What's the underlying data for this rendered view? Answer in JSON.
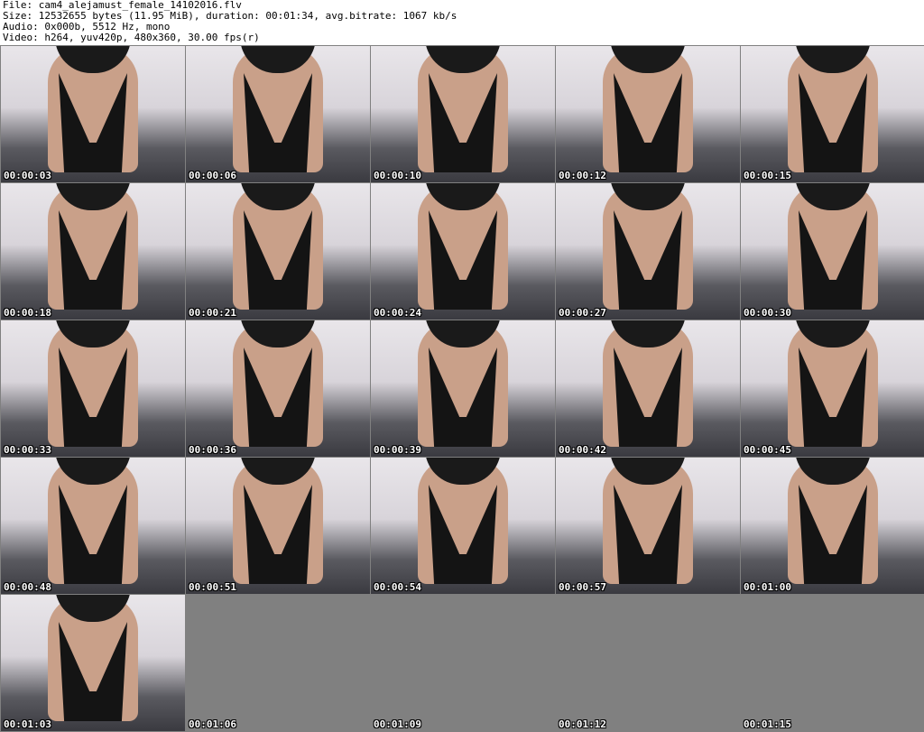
{
  "header": {
    "file": "File: cam4_alejamust_female_14102016.flv",
    "size": "Size: 12532655 bytes (11.95 MiB), duration: 00:01:34, avg.bitrate: 1067 kb/s",
    "audio": "Audio: 0x000b, 5512 Hz, mono",
    "video": "Video: h264, yuv420p, 480x360, 30.00 fps(r)"
  },
  "thumbnails": [
    {
      "time": "00:00:03",
      "filled": true
    },
    {
      "time": "00:00:06",
      "filled": true
    },
    {
      "time": "00:00:10",
      "filled": true
    },
    {
      "time": "00:00:12",
      "filled": true
    },
    {
      "time": "00:00:15",
      "filled": true
    },
    {
      "time": "00:00:18",
      "filled": true
    },
    {
      "time": "00:00:21",
      "filled": true
    },
    {
      "time": "00:00:24",
      "filled": true
    },
    {
      "time": "00:00:27",
      "filled": true
    },
    {
      "time": "00:00:30",
      "filled": true
    },
    {
      "time": "00:00:33",
      "filled": true
    },
    {
      "time": "00:00:36",
      "filled": true
    },
    {
      "time": "00:00:39",
      "filled": true
    },
    {
      "time": "00:00:42",
      "filled": true
    },
    {
      "time": "00:00:45",
      "filled": true
    },
    {
      "time": "00:00:48",
      "filled": true
    },
    {
      "time": "00:00:51",
      "filled": true
    },
    {
      "time": "00:00:54",
      "filled": true
    },
    {
      "time": "00:00:57",
      "filled": true
    },
    {
      "time": "00:01:00",
      "filled": true
    },
    {
      "time": "00:01:03",
      "filled": true
    },
    {
      "time": "00:01:06",
      "filled": false
    },
    {
      "time": "00:01:09",
      "filled": false
    },
    {
      "time": "00:01:12",
      "filled": false
    },
    {
      "time": "00:01:15",
      "filled": false
    }
  ]
}
